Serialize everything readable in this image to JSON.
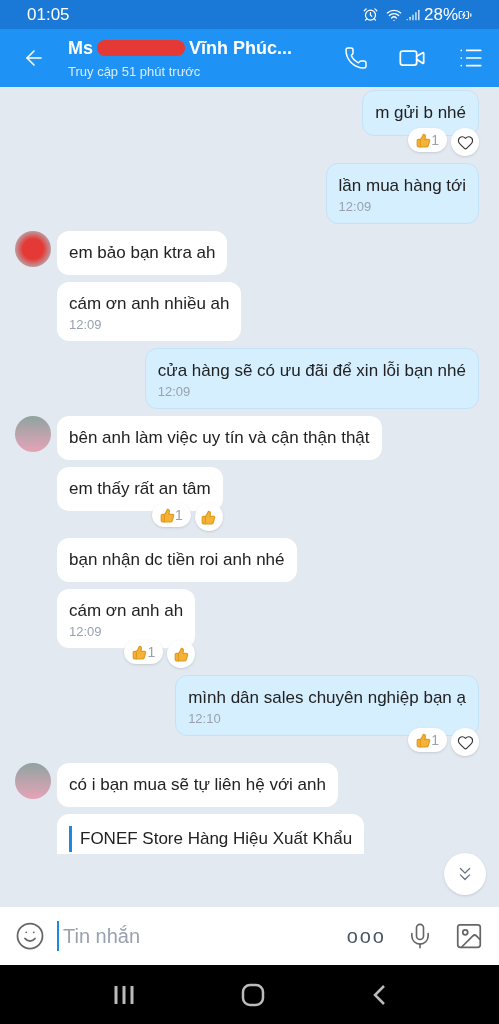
{
  "status_bar": {
    "time": "01:05",
    "battery": "28%"
  },
  "header": {
    "title_start": "Ms",
    "title_end": "Vĩnh Phúc...",
    "subtitle": "Truy cập 51 phút trước"
  },
  "messages": [
    {
      "kind": "text",
      "outgoing": true,
      "text": "m gửi b nhé",
      "reactions": [
        {
          "kind": "count",
          "count": "1"
        },
        {
          "kind": "heart"
        }
      ]
    },
    {
      "kind": "text",
      "outgoing": true,
      "text": "lần mua hàng tới",
      "time": "12:09"
    },
    {
      "kind": "text",
      "outgoing": false,
      "avatar": true,
      "avatar_redacted": true,
      "text": "em bảo bạn ktra ah"
    },
    {
      "kind": "text",
      "outgoing": false,
      "text": "cám ơn anh nhiều ah",
      "time": "12:09"
    },
    {
      "kind": "text",
      "outgoing": true,
      "text": "cửa hàng sẽ có ưu đãi để xin lỗi bạn nhé",
      "time": "12:09"
    },
    {
      "kind": "text",
      "outgoing": false,
      "avatar": true,
      "text": "bên anh làm việc uy tín và cận thận thật"
    },
    {
      "kind": "text",
      "outgoing": false,
      "text": "em thấy rất an tâm",
      "reactions": [
        {
          "kind": "count",
          "count": "1"
        },
        {
          "kind": "thumb"
        }
      ]
    },
    {
      "kind": "text",
      "outgoing": false,
      "text": "bạn nhận dc tiền roi anh nhé"
    },
    {
      "kind": "text",
      "outgoing": false,
      "text": "cám ơn anh ah",
      "time": "12:09",
      "reactions": [
        {
          "kind": "count",
          "count": "1"
        },
        {
          "kind": "thumb"
        }
      ]
    },
    {
      "kind": "text",
      "outgoing": true,
      "text": "mình dân sales chuyên nghiệp bạn ạ",
      "time": "12:10",
      "reactions": [
        {
          "kind": "count",
          "count": "1"
        },
        {
          "kind": "heart"
        }
      ]
    },
    {
      "kind": "text",
      "outgoing": false,
      "avatar": true,
      "text": "có i bạn mua sẽ tự liên hệ với anh"
    },
    {
      "kind": "link",
      "outgoing": false,
      "text": "FONEF Store  Hàng Hiệu Xuất Khẩu"
    }
  ],
  "composer": {
    "placeholder": "Tin nhắn",
    "more": "ooo"
  }
}
